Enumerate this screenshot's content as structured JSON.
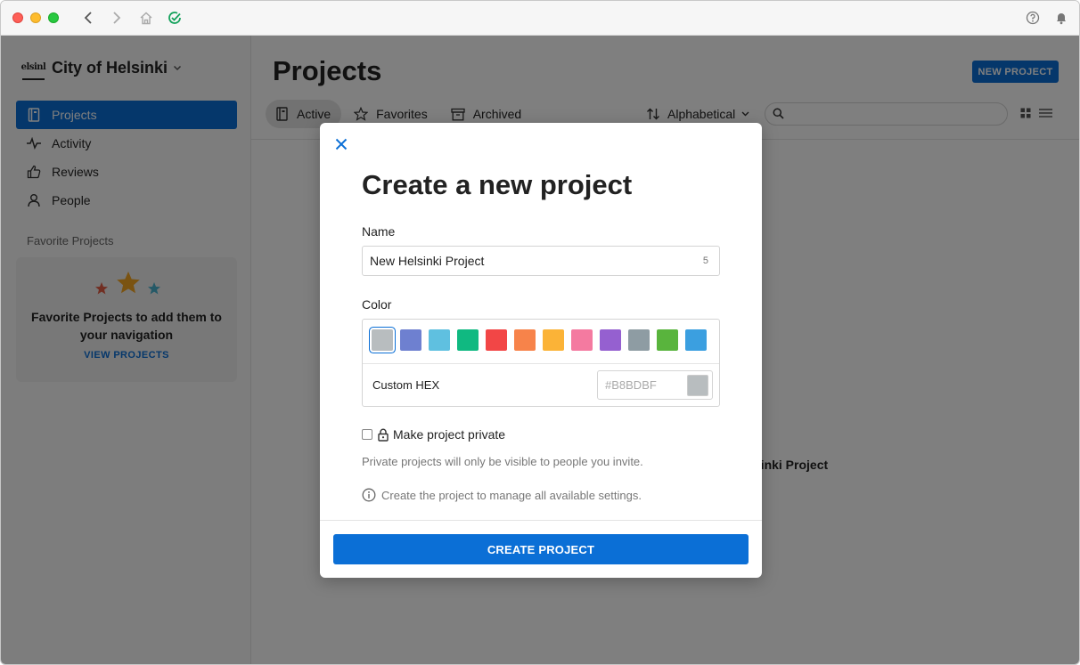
{
  "sidebar": {
    "org_logo_text": "elsinl",
    "org_name": "City of Helsinki",
    "nav": [
      {
        "label": "Projects",
        "icon": "notebook-icon",
        "active": true
      },
      {
        "label": "Activity",
        "icon": "pulse-icon"
      },
      {
        "label": "Reviews",
        "icon": "thumbs-up-icon"
      },
      {
        "label": "People",
        "icon": "person-icon"
      }
    ],
    "favorites_heading": "Favorite Projects",
    "favorites_empty_text": "Favorite Projects to add them to your navigation",
    "favorites_link": "VIEW PROJECTS"
  },
  "main": {
    "title": "Projects",
    "new_project_label": "NEW PROJECT",
    "tabs": [
      {
        "label": "Active",
        "icon": "notebook-icon",
        "active": true
      },
      {
        "label": "Favorites",
        "icon": "star-icon"
      },
      {
        "label": "Archived",
        "icon": "archive-box-icon"
      }
    ],
    "sort_label": "Alphabetical",
    "search_placeholder": "",
    "behind_modal_text": "lsinki Project"
  },
  "modal": {
    "title": "Create a new project",
    "name_label": "Name",
    "name_value": "New Helsinki Project",
    "name_count": "5",
    "color_label": "Color",
    "swatches": [
      "#B8BDBF",
      "#6E80D0",
      "#5FC0E0",
      "#10B981",
      "#F24646",
      "#F7834A",
      "#FBB337",
      "#F47AA0",
      "#9560D0",
      "#8E9CA3",
      "#59B43D",
      "#3B9FE0"
    ],
    "selected_swatch": "#B8BDBF",
    "custom_hex_label": "Custom HEX",
    "custom_hex_placeholder": "#B8BDBF",
    "private_label": "Make project private",
    "private_checked": false,
    "private_helper": "Private projects will only be visible to people you invite.",
    "info_text": "Create the project to manage all available settings.",
    "create_label": "CREATE PROJECT"
  },
  "colors": {
    "accent": "#0B6FD6",
    "overlay": "rgba(0,0,0,0.5)"
  }
}
